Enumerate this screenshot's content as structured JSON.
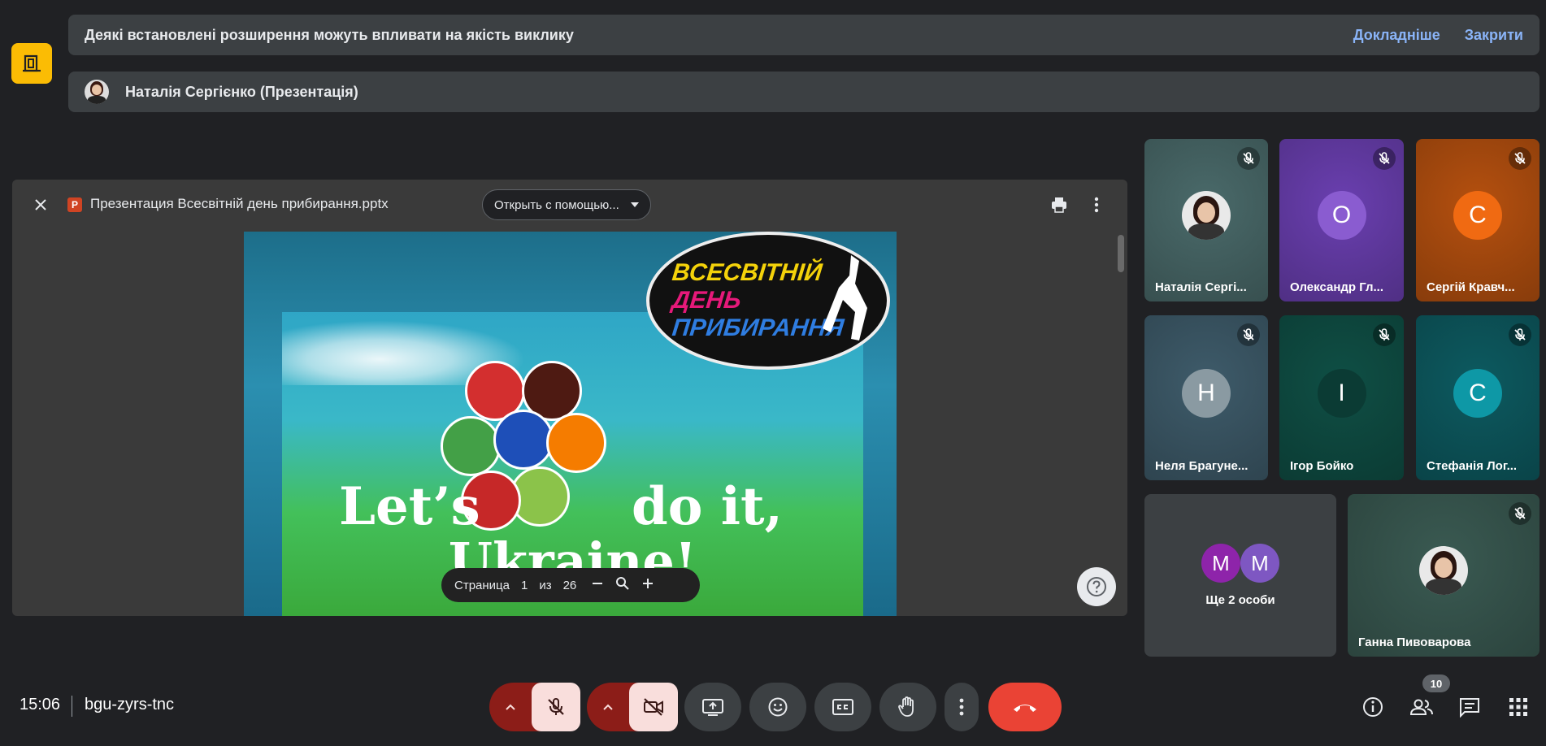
{
  "notice": {
    "text": "Деякі встановлені розширення можуть впливати на якість виклику",
    "more": "Докладніше",
    "close": "Закрити"
  },
  "presenter": {
    "label": "Наталія Сергієнко (Презентація)"
  },
  "viewer": {
    "filename": "Презентация Всесвітній день прибирання.pptx",
    "open_with": "Открыть с помощью...",
    "slide": {
      "badge_lines": [
        "ВСЕСВІТНІЙ",
        "ДЕНЬ",
        "ПРИБИРАННЯ"
      ],
      "line1": "Let’s",
      "line2": "do it,",
      "line3": "Ukraine!"
    },
    "pager": {
      "page_label": "Страница",
      "current": "1",
      "of": "из",
      "total": "26"
    }
  },
  "participants": [
    {
      "name": "Наталія Сергі...",
      "initial": "",
      "bg": "#4a6a6a",
      "avatar": "photo"
    },
    {
      "name": "Олександр Гл...",
      "initial": "О",
      "bg": "#6a3fb0",
      "avatar_color": "#8a5cd0"
    },
    {
      "name": "Сергій Кравч...",
      "initial": "С",
      "bg": "#b5500f",
      "avatar_color": "#f06a12"
    },
    {
      "name": "Неля Брагуне...",
      "initial": "Н",
      "bg": "#3e5b6a",
      "avatar_color": "#8a9aa2"
    },
    {
      "name": "Ігор Бойко",
      "initial": "І",
      "bg": "#0f4f45",
      "avatar_color": "#0b3b34"
    },
    {
      "name": "Стефанія Лог...",
      "initial": "С",
      "bg": "#0d5a60",
      "avatar_color": "#0e98a6"
    },
    {
      "name": "Ганна Пивоварова",
      "initial": "",
      "bg": "#3a5a52",
      "avatar": "photo"
    }
  ],
  "others": {
    "label": "Ще 2 особи",
    "initials": [
      "М",
      "М"
    ],
    "colors": [
      "#8e24aa",
      "#7e57c2"
    ]
  },
  "meeting": {
    "time": "15:06",
    "code": "bgu-zyrs-tnc",
    "participant_count": "10"
  },
  "colors": {
    "end_call": "#ea4335",
    "mic_off_bg": "#f9dedc",
    "split_bg": "#8c1d18"
  }
}
